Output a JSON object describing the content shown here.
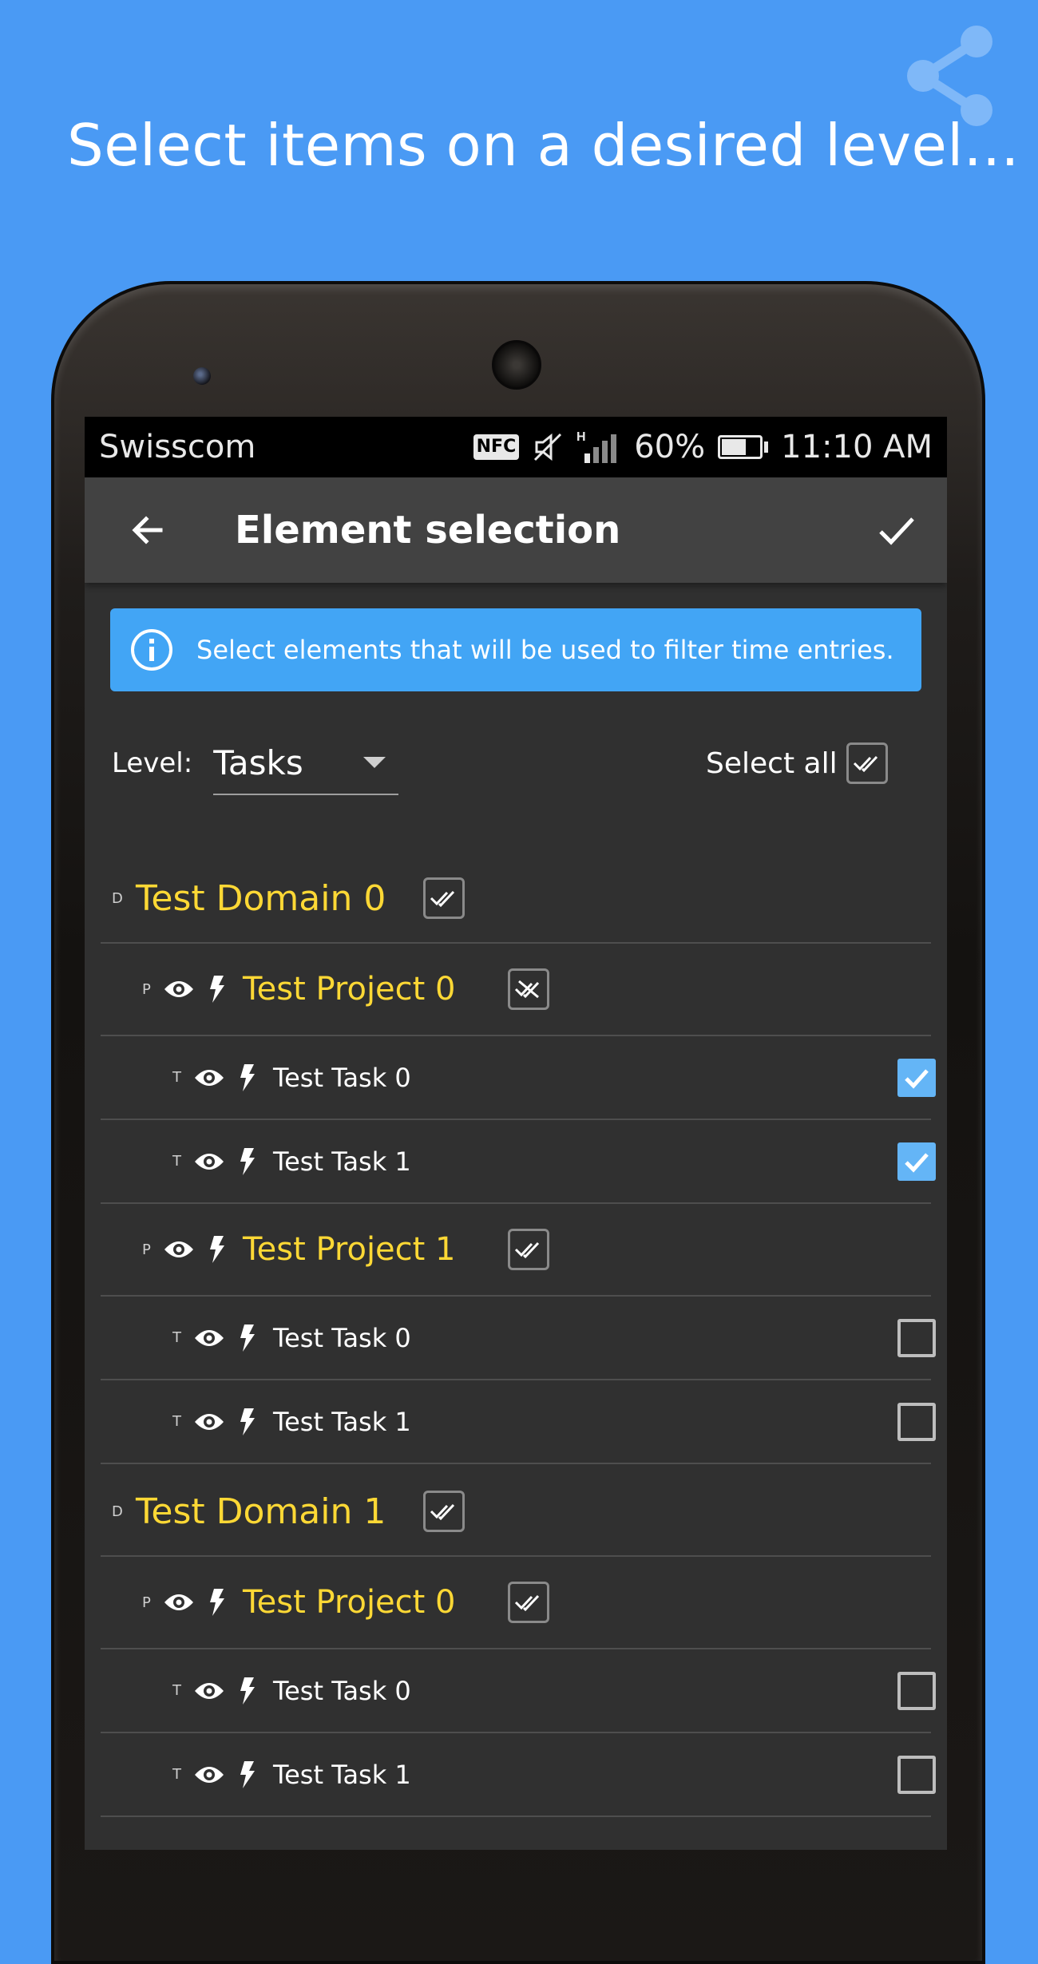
{
  "headline": "Select items on a desired level...",
  "status_bar": {
    "carrier": "Swisscom",
    "nfc_badge": "NFC",
    "battery": "60%",
    "battery_level": 0.6,
    "time": "11:10 AM"
  },
  "app_bar": {
    "title": "Element selection",
    "back_icon": "arrow-back-icon",
    "done_icon": "check-icon"
  },
  "info": {
    "text": "Select elements that will be used to filter time entries.",
    "icon": "info-icon"
  },
  "level": {
    "label": "Level:",
    "value": "Tasks",
    "select_all_label": "Select all"
  },
  "colors": {
    "background": "#4a9af4",
    "screen": "#303030",
    "app_bar": "#424242",
    "info": "#42a5f5",
    "accent_yellow": "#fdd835",
    "check_blue": "#64b5f6"
  },
  "domains": [
    {
      "letter": "D",
      "name": "Test Domain 0",
      "projects": [
        {
          "letter": "P",
          "name": "Test Project 0",
          "state": "deselect",
          "tasks": [
            {
              "letter": "T",
              "name": "Test Task 0",
              "checked": true
            },
            {
              "letter": "T",
              "name": "Test Task 1",
              "checked": true
            }
          ]
        },
        {
          "letter": "P",
          "name": "Test Project 1",
          "state": "select",
          "tasks": [
            {
              "letter": "T",
              "name": "Test Task 0",
              "checked": false
            },
            {
              "letter": "T",
              "name": "Test Task 1",
              "checked": false
            }
          ]
        }
      ]
    },
    {
      "letter": "D",
      "name": "Test Domain 1",
      "projects": [
        {
          "letter": "P",
          "name": "Test Project 0",
          "state": "select",
          "tasks": [
            {
              "letter": "T",
              "name": "Test Task 0",
              "checked": false
            },
            {
              "letter": "T",
              "name": "Test Task 1",
              "checked": false
            }
          ]
        }
      ]
    }
  ]
}
